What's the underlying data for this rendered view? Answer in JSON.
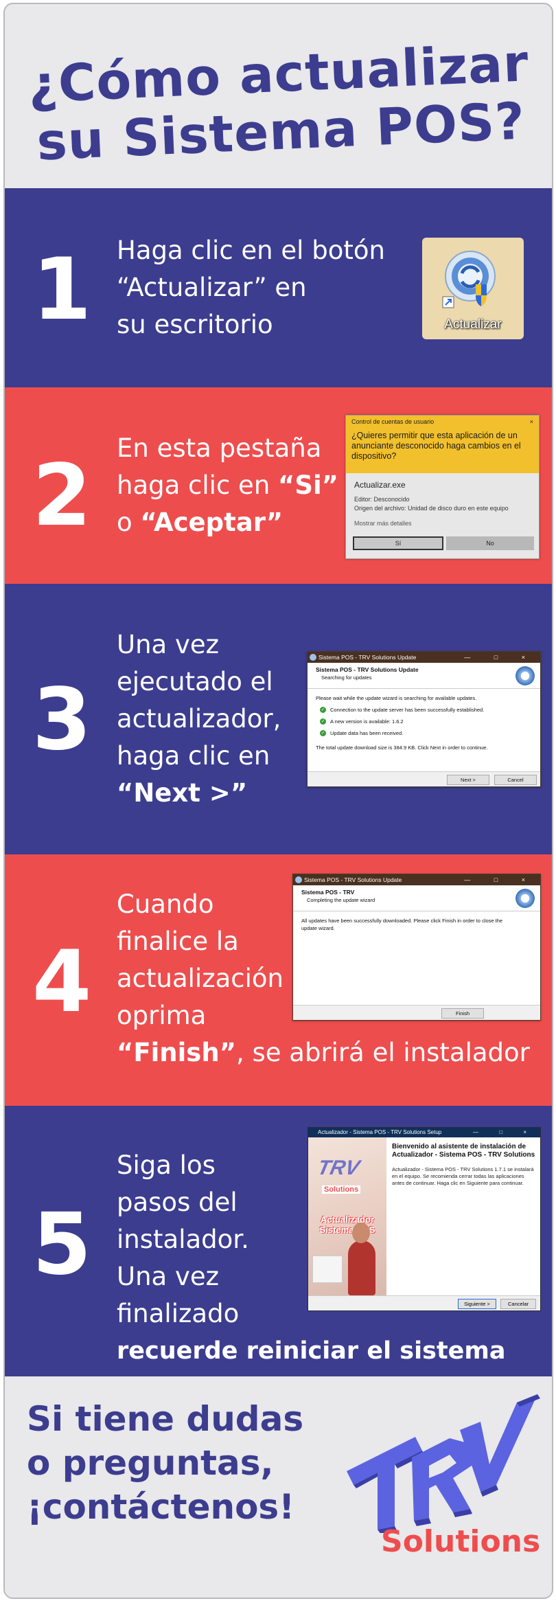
{
  "title": {
    "line1": "¿Cómo actualizar",
    "line2": "su Sistema POS?"
  },
  "colors": {
    "navy": "#3c3d8f",
    "coral": "#ee4d4e",
    "background": "#e9e8ea",
    "uac_yellow": "#f2c02c"
  },
  "step1": {
    "number": "1",
    "lines": [
      "Haga clic en el botón",
      "“Actualizar” en",
      "su escritorio"
    ],
    "icon": {
      "name": "actualizar-shortcut-icon",
      "label": "Actualizar"
    }
  },
  "step2": {
    "number": "2",
    "line1": "En esta pestaña",
    "line2_pre": "haga clic en ",
    "line2_bold": "“Si”",
    "line3_pre": "o ",
    "line3_bold": "“Aceptar”",
    "dialog": {
      "header": "Control de cuentas de usuario",
      "close": "×",
      "question": "¿Quieres permitir que esta aplicación de un anunciante desconocido haga cambios en el dispositivo?",
      "app": "Actualizar.exe",
      "publisher": "Editor: Desconocido",
      "origin": "Origen del archivo: Unidad de disco duro en este equipo",
      "more": "Mostrar más detalles",
      "yes": "Sí",
      "no": "No"
    }
  },
  "step3": {
    "number": "3",
    "lines": [
      "Una vez",
      "ejecutado el",
      "actualizador,",
      "haga clic en"
    ],
    "bold": "“Next >”",
    "window": {
      "titlebar": "Sistema POS - TRV Solutions Update",
      "controls": "— □ ×",
      "heading": "Sistema POS - TRV Solutions Update",
      "subheading": "Searching for updates",
      "intro": "Please wait while the update wizard is searching for available updates.",
      "checks": [
        "Connection to the update server has been successfully established.",
        "A new version is available: 1.6.2",
        "Update data has been received."
      ],
      "total": "The total update download size is 384.9 KB. Click Next in order to continue.",
      "next": "Next >",
      "cancel": "Cancel"
    }
  },
  "step4": {
    "number": "4",
    "lines": [
      "Cuando",
      "finalice la",
      "actualización",
      "oprima"
    ],
    "bold": "“Finish”",
    "rest": ", se abrirá el instalador",
    "window": {
      "titlebar": "Sistema POS - TRV Solutions Update",
      "controls": "— □ ×",
      "heading": "Sistema POS - TRV",
      "subheading": "Completing the update wizard",
      "body": "All updates have been successfully downloaded. Please click Finish in order to close the update wizard.",
      "finish": "Finish"
    }
  },
  "step5": {
    "number": "5",
    "lines": [
      "Siga los",
      "pasos del",
      "instalador.",
      "Una vez",
      "finalizado"
    ],
    "bold": "recuerde reiniciar el sistema",
    "window": {
      "titlebar": "Actualizador - Sistema POS - TRV Solutions Setup",
      "controls": "— □ ×",
      "side_solutions": "Solutions",
      "side_title": "Actualizador Sistema POS",
      "heading": "Bienvenido al asistente de instalación de Actualizador - Sistema POS - TRV Solutions",
      "body": "Actualizador - Sistema POS - TRV Solutions 1.7.1 se instalará en el equipo. Se recomienda cerrar todas las aplicaciones antes de continuar. Haga clic en Siguiente para continuar.",
      "next": "Siguiente >",
      "cancel": "Cancelar"
    }
  },
  "footer": {
    "lines": [
      "Si tiene dudas",
      "o preguntas,",
      "¡contáctenos!"
    ],
    "logo_text": "Solutions"
  }
}
